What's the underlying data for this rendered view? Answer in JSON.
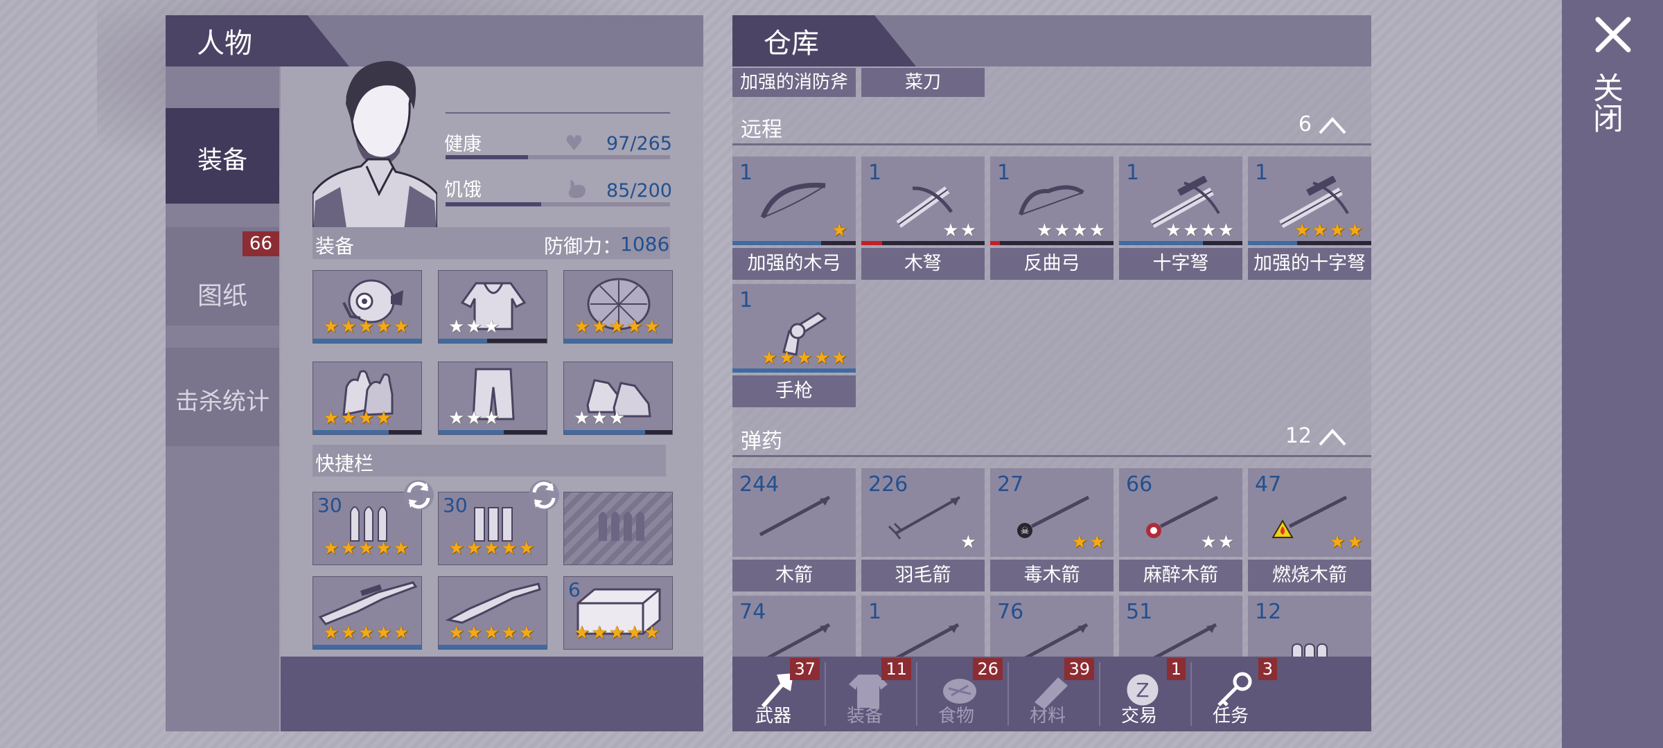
{
  "character_panel": {
    "title": "人物",
    "side_tabs": [
      {
        "label": "装备"
      },
      {
        "label": "图纸",
        "badge": "66"
      },
      {
        "label": "击杀统计"
      }
    ],
    "stats": {
      "health_label": "健康",
      "health_value": "97/265",
      "health_fraction": 0.366,
      "hunger_label": "饥饿",
      "hunger_value": "85/200",
      "hunger_fraction": 0.425
    },
    "equipment": {
      "label": "装备",
      "defense_label": "防御力：",
      "defense_value": "1086",
      "slots": [
        {
          "icon": "gas-mask-icon",
          "stars_gold": 5,
          "stars_white": 0,
          "durability": 1.0
        },
        {
          "icon": "hoodie-icon",
          "stars_gold": 0,
          "stars_white": 3,
          "durability": 0.45
        },
        {
          "icon": "turtle-shell-icon",
          "stars_gold": 5,
          "stars_white": 0,
          "durability": 1.0
        },
        {
          "icon": "gloves-icon",
          "stars_gold": 4,
          "stars_white": 0,
          "durability": 0.7
        },
        {
          "icon": "pants-icon",
          "stars_gold": 0,
          "stars_white": 3,
          "durability": 0.6
        },
        {
          "icon": "sneakers-icon",
          "stars_gold": 0,
          "stars_white": 3,
          "durability": 0.75
        }
      ]
    },
    "quickbar": {
      "label": "快捷栏",
      "slots": [
        {
          "icon": "rifle-ammo-icon",
          "count": "30",
          "stars_gold": 5,
          "reload": true
        },
        {
          "icon": "shotgun-shells-icon",
          "count": "30",
          "stars_gold": 5,
          "reload": true
        },
        {
          "icon": "locked-ammo-icon",
          "count": "",
          "stars_gold": 0,
          "locked": true
        },
        {
          "icon": "rifle-icon",
          "count": "",
          "stars_gold": 5,
          "durability": 1.0
        },
        {
          "icon": "shotgun-icon",
          "count": "",
          "stars_gold": 5,
          "durability": 1.0
        },
        {
          "icon": "brick-icon",
          "count": "6",
          "stars_gold": 5
        }
      ]
    }
  },
  "warehouse_panel": {
    "title": "仓库",
    "melee_tail": [
      "加强的消防斧",
      "菜刀"
    ],
    "ranged": {
      "label": "远程",
      "count": "6",
      "items": [
        {
          "name": "加强的木弓",
          "count": "1",
          "icon": "bow-icon",
          "stars_gold": 1,
          "stars_white": 0,
          "durability": 0.72,
          "bar_color": "#3f6ba0"
        },
        {
          "name": "木弩",
          "count": "1",
          "icon": "crossbow-icon",
          "stars_gold": 0,
          "stars_white": 2,
          "durability": 0.17,
          "bar_color": "#c32026"
        },
        {
          "name": "反曲弓",
          "count": "1",
          "icon": "recurve-bow-icon",
          "stars_gold": 0,
          "stars_white": 4,
          "durability": 0.08,
          "bar_color": "#c32026"
        },
        {
          "name": "十字弩",
          "count": "1",
          "icon": "scoped-crossbow-icon",
          "stars_gold": 0,
          "stars_white": 4,
          "durability": 0.68,
          "bar_color": "#3f6ba0"
        },
        {
          "name": "加强的十字弩",
          "count": "1",
          "icon": "reinforced-crossbow-icon",
          "stars_gold": 4,
          "stars_white": 0,
          "durability": 0.4,
          "bar_color": "#3f6ba0"
        },
        {
          "name": "手枪",
          "count": "1",
          "icon": "revolver-icon",
          "stars_gold": 5,
          "stars_white": 0,
          "durability": 1.0,
          "bar_color": "#3f6ba0"
        }
      ]
    },
    "ammo": {
      "label": "弹药",
      "count": "12",
      "items": [
        {
          "name": "木箭",
          "count": "244",
          "icon": "wooden-arrow-icon",
          "stars_gold": 0,
          "stars_white": 0
        },
        {
          "name": "羽毛箭",
          "count": "226",
          "icon": "feather-arrow-icon",
          "stars_gold": 0,
          "stars_white": 1
        },
        {
          "name": "毒木箭",
          "count": "27",
          "icon": "poison-arrow-icon",
          "stars_gold": 2,
          "stars_white": 0
        },
        {
          "name": "麻醉木箭",
          "count": "66",
          "icon": "tranquilizer-arrow-icon",
          "stars_gold": 0,
          "stars_white": 2
        },
        {
          "name": "燃烧木箭",
          "count": "47",
          "icon": "fire-arrow-icon",
          "stars_gold": 2,
          "stars_white": 0
        },
        {
          "name": "",
          "count": "74",
          "icon": "spear-arrow-icon"
        },
        {
          "name": "",
          "count": "1",
          "icon": "arrow-icon"
        },
        {
          "name": "",
          "count": "76",
          "icon": "arrow-icon"
        },
        {
          "name": "",
          "count": "51",
          "icon": "arrow-icon"
        },
        {
          "name": "",
          "count": "12",
          "icon": "bullets-icon"
        }
      ]
    },
    "bottom_tabs": [
      {
        "label": "武器",
        "badge": "37",
        "icon": "axe-icon",
        "active": true
      },
      {
        "label": "装备",
        "badge": "11",
        "icon": "shirt-icon",
        "active": false
      },
      {
        "label": "食物",
        "badge": "26",
        "icon": "meat-icon",
        "active": false
      },
      {
        "label": "材料",
        "badge": "39",
        "icon": "log-icon",
        "active": false
      },
      {
        "label": "交易",
        "badge": "1",
        "icon": "coin-icon",
        "active": true
      },
      {
        "label": "任务",
        "badge": "3",
        "icon": "key-icon",
        "active": true
      }
    ]
  },
  "close_panel": {
    "label": "关闭"
  }
}
